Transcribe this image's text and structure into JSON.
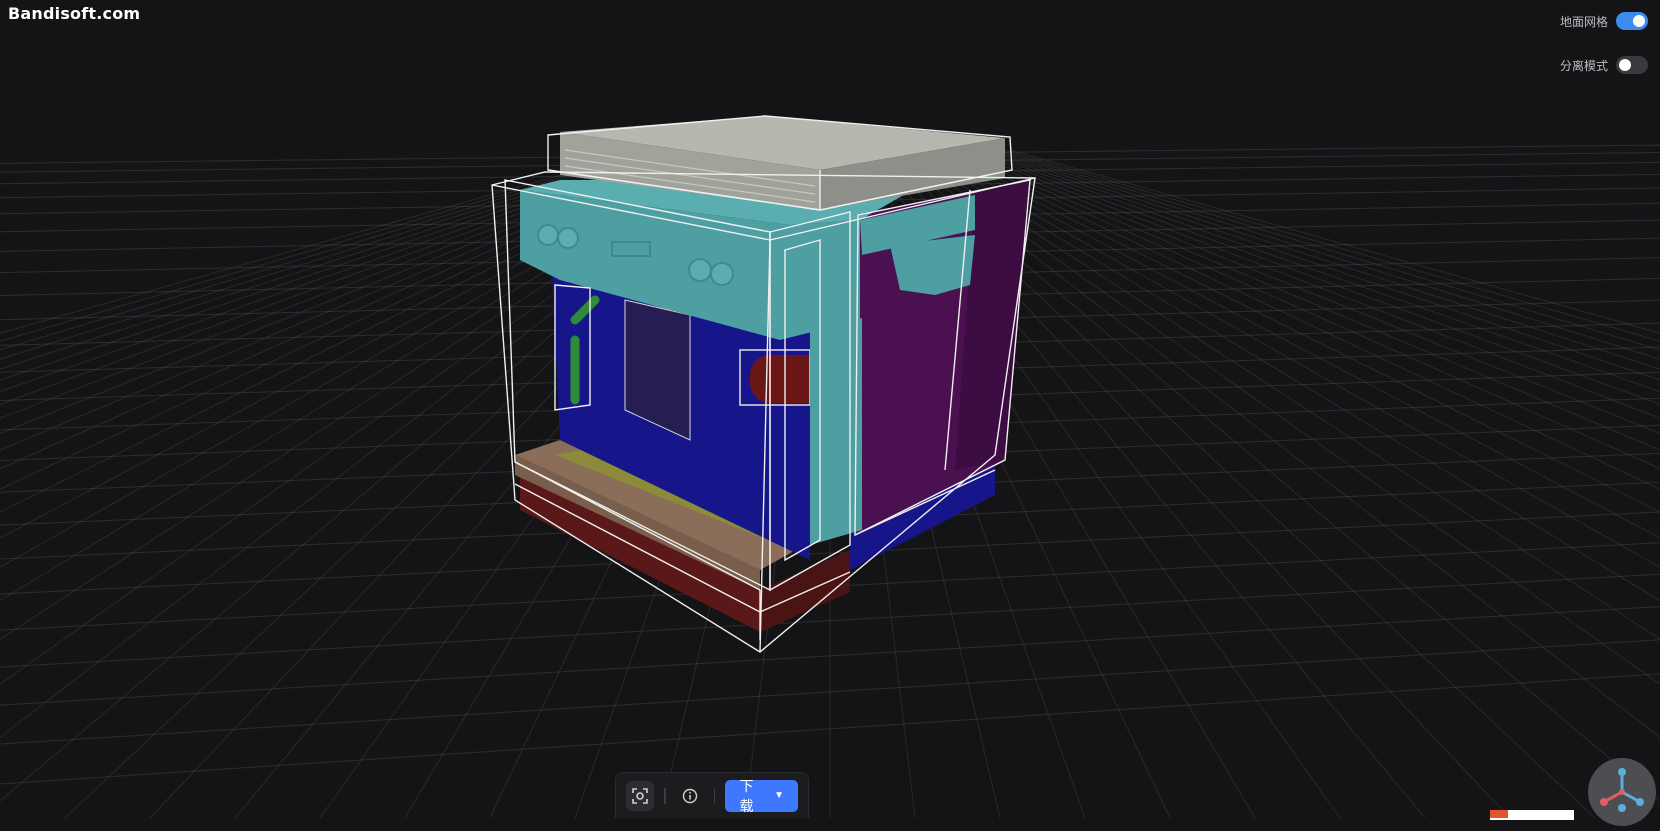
{
  "watermark": "Bandisoft.com",
  "controls": {
    "ground_grid": {
      "label": "地面网格",
      "on": true
    },
    "explode_mode": {
      "label": "分离模式",
      "on": false
    }
  },
  "toolbar": {
    "download_label": "下载",
    "download_caret": "▼"
  },
  "icons": [
    "screenshot-icon",
    "info-icon",
    "axis-gizmo-icon"
  ],
  "colors": {
    "background": "#141416",
    "grid": "#5a5a60",
    "accent": "#3d78ff",
    "part_cyan": "#4d9fa2",
    "part_blue": "#16168a",
    "part_purple": "#4a1050",
    "part_darkred": "#5b1818",
    "part_tan": "#8a6e5a",
    "part_olive": "#8b8b3a",
    "part_gray": "#9fa39a"
  }
}
